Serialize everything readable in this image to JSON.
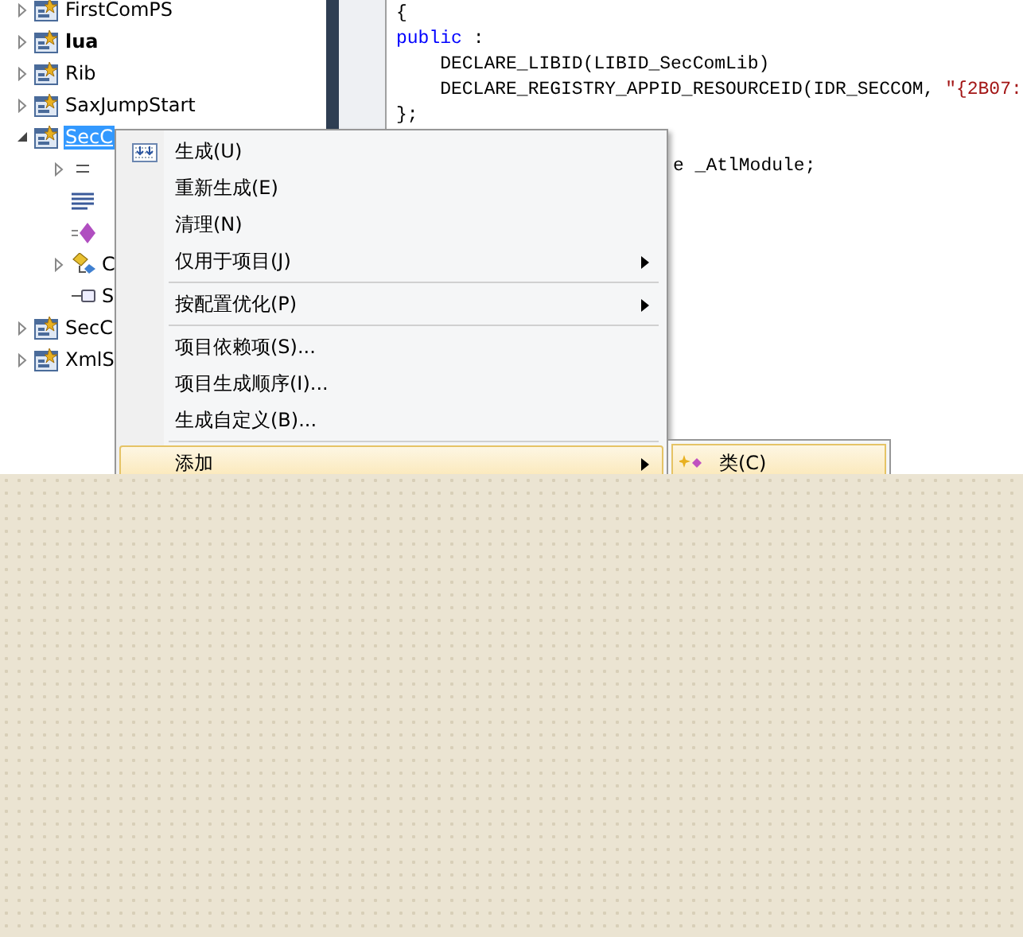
{
  "solution_tree": [
    {
      "label": "FirstComPS",
      "expanded": false,
      "bold": false,
      "selected": false
    },
    {
      "label": "lua",
      "expanded": false,
      "bold": true,
      "selected": false
    },
    {
      "label": "Rib",
      "expanded": false,
      "bold": false,
      "selected": false
    },
    {
      "label": "SaxJumpStart",
      "expanded": false,
      "bold": false,
      "selected": false
    },
    {
      "label": "SecC",
      "expanded": true,
      "bold": false,
      "selected": true,
      "children": [
        {
          "kind": "folder-lines",
          "expandable": true
        },
        {
          "kind": "list",
          "expandable": false
        },
        {
          "kind": "diamond",
          "expandable": false
        },
        {
          "label": "C",
          "kind": "class",
          "expandable": true
        },
        {
          "label": "S",
          "kind": "interface",
          "expandable": false
        }
      ]
    },
    {
      "label": "SecC",
      "expanded": false,
      "bold": false,
      "selected": false
    },
    {
      "label": "XmlS",
      "expanded": false,
      "bold": false,
      "selected": false
    }
  ],
  "code_lines": [
    [
      {
        "text": "{",
        "kind": "plain"
      }
    ],
    [
      {
        "text": "public",
        "kind": "keyword"
      },
      {
        "text": " :",
        "kind": "plain"
      }
    ],
    [
      {
        "text": "    DECLARE_LIBID(LIBID_SecComLib)",
        "kind": "plain"
      }
    ],
    [
      {
        "text": "    DECLARE_REGISTRY_APPID_RESOURCEID(IDR_SECCOM, ",
        "kind": "plain"
      },
      {
        "text": "\"{2B07:",
        "kind": "string"
      }
    ],
    [
      {
        "text": "};",
        "kind": "plain"
      }
    ],
    [
      {
        "text": "e _AtlModule;",
        "kind": "covered"
      }
    ]
  ],
  "context_menu": [
    {
      "label": "生成(U)",
      "icon": true,
      "submenu": false,
      "separator_after": false,
      "selected": false
    },
    {
      "label": "重新生成(E)",
      "icon": false,
      "submenu": false,
      "separator_after": false,
      "selected": false
    },
    {
      "label": "清理(N)",
      "icon": false,
      "submenu": false,
      "separator_after": false,
      "selected": false
    },
    {
      "label": "仅用于项目(J)",
      "icon": false,
      "submenu": true,
      "separator_after": true,
      "selected": false
    },
    {
      "label": "按配置优化(P)",
      "icon": false,
      "submenu": true,
      "separator_after": true,
      "selected": false
    },
    {
      "label": "项目依赖项(S)...",
      "icon": false,
      "submenu": false,
      "separator_after": false,
      "selected": false
    },
    {
      "label": "项目生成顺序(I)...",
      "icon": false,
      "submenu": false,
      "separator_after": false,
      "selected": false
    },
    {
      "label": "生成自定义(B)...",
      "icon": false,
      "submenu": false,
      "separator_after": true,
      "selected": false
    },
    {
      "label": "添加",
      "icon": false,
      "submenu": true,
      "separator_after": false,
      "selected": true
    }
  ],
  "submenu": [
    {
      "label": "类(C)",
      "selected": true
    }
  ]
}
